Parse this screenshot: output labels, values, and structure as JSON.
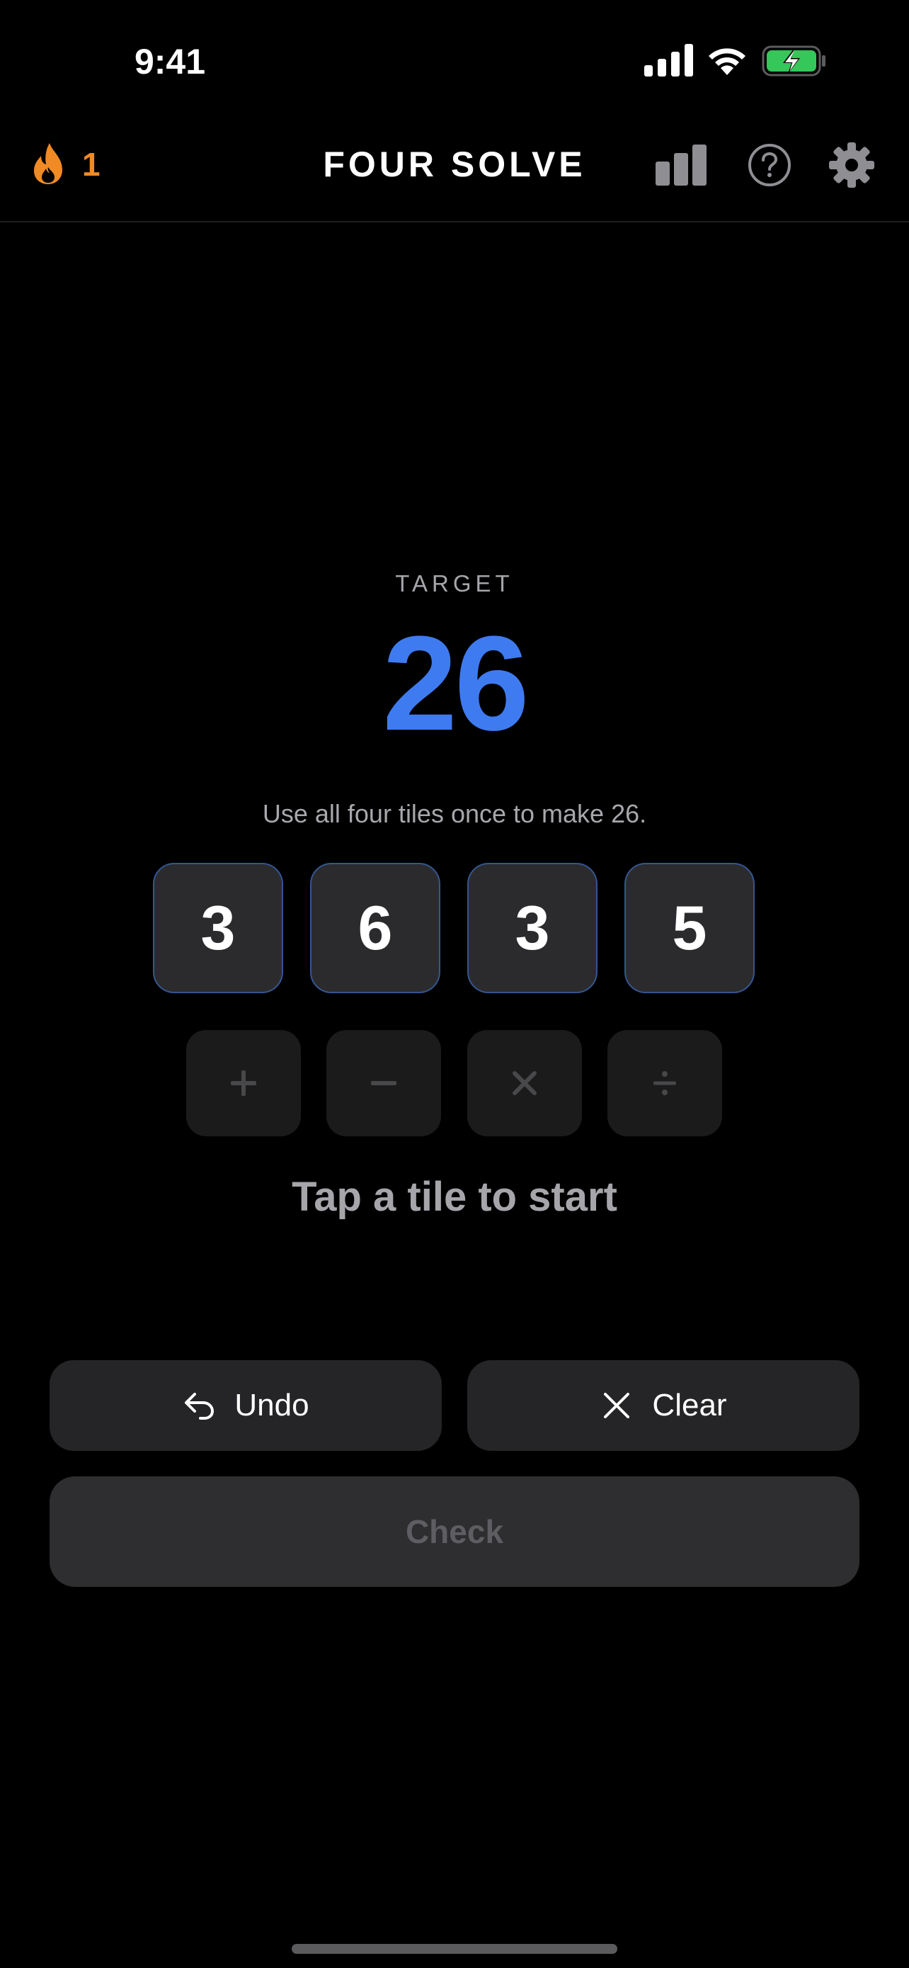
{
  "status_bar": {
    "time": "9:41"
  },
  "header": {
    "streak_count": "1",
    "title": "FOUR SOLVE",
    "icons": [
      "flame-icon",
      "stats-icon",
      "help-icon",
      "gear-icon"
    ]
  },
  "target": {
    "label": "TARGET",
    "value": "26",
    "instruction": "Use all four tiles once to make 26."
  },
  "tiles": [
    "3",
    "6",
    "3",
    "5"
  ],
  "operators": [
    "plus",
    "minus",
    "multiply",
    "divide"
  ],
  "hint": "Tap a tile to start",
  "actions": {
    "undo_label": "Undo",
    "clear_label": "Clear",
    "check_label": "Check"
  },
  "colors": {
    "accent": "#3f7bf0",
    "streak": "#f08a24",
    "background": "#000000",
    "battery": "#35c759"
  }
}
